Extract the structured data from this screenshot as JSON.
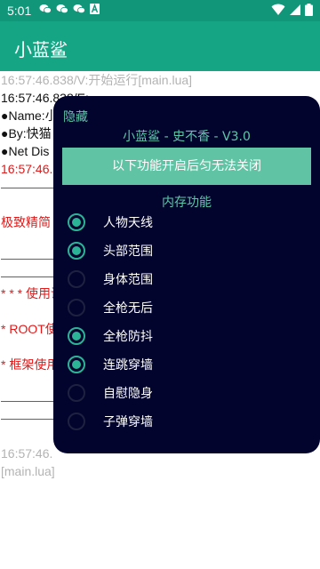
{
  "status_bar": {
    "time": "5:01",
    "notification_icons": [
      "wechat-icon",
      "wechat-icon",
      "wechat-icon",
      "app-a-icon"
    ],
    "right_icons": [
      "wifi-icon",
      "signal-icon",
      "battery-icon"
    ]
  },
  "app_bar": {
    "title": "小蓝鲨"
  },
  "log_lines": [
    {
      "text": "16:57:46.838/V:开始运行[main.lua]",
      "color": "gray"
    },
    {
      "text": "16:57:46.838/E:",
      "color": "black"
    },
    {
      "text": "●Name:小",
      "color": "black"
    },
    {
      "text": "●By:快猫",
      "color": "black"
    },
    {
      "text": "●Net Dis",
      "color": "black"
    },
    {
      "text": "16:57:46.",
      "color": "red"
    },
    {
      "text": "——————",
      "color": "red"
    },
    {
      "text": "",
      "color": "red"
    },
    {
      "text": "  极致精简",
      "color": "red"
    },
    {
      "text": "",
      "color": "red"
    },
    {
      "text": "——————",
      "color": "red"
    },
    {
      "text": "——————",
      "color": "red"
    },
    {
      "text": "* * * 使用说",
      "color": "red"
    },
    {
      "text": "",
      "color": "red"
    },
    {
      "text": "* ROOT使",
      "color": "red"
    },
    {
      "text": "",
      "color": "red"
    },
    {
      "text": "* 框架使用",
      "color": "red"
    },
    {
      "text": "",
      "color": "red"
    },
    {
      "text": "——————",
      "color": "red"
    },
    {
      "text": "——————",
      "color": "red"
    },
    {
      "text": "",
      "color": "red"
    },
    {
      "text": "16:57:46.",
      "color": "gray"
    },
    {
      "text": "[main.lua]",
      "color": "gray"
    }
  ],
  "dialog": {
    "hide_label": "隐藏",
    "title": "小蓝鲨 - 史不香 - V3.0",
    "notice_button": "以下功能开启后匀无法关闭",
    "section_title": "内存功能",
    "options": [
      {
        "label": "人物天线",
        "checked": true
      },
      {
        "label": "头部范围",
        "checked": true
      },
      {
        "label": "身体范围",
        "checked": false
      },
      {
        "label": "全枪无后",
        "checked": false
      },
      {
        "label": "全枪防抖",
        "checked": true
      },
      {
        "label": "连跳穿墙",
        "checked": true
      },
      {
        "label": "自慰隐身",
        "checked": false
      },
      {
        "label": "子弹穿墙",
        "checked": false
      }
    ]
  }
}
